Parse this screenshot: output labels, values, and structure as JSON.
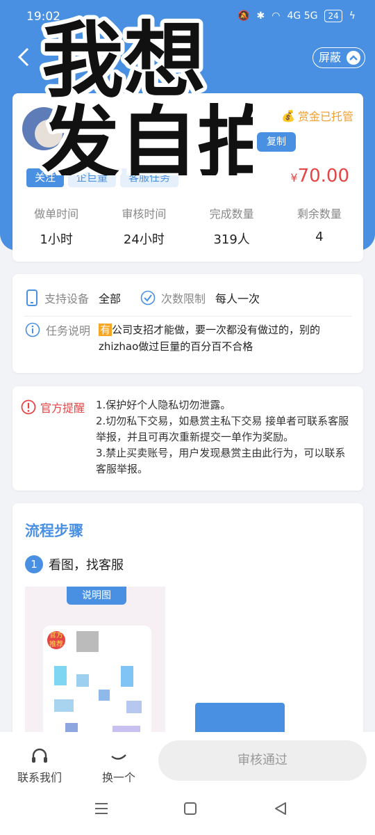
{
  "status_bar": {
    "time": "19:02",
    "network": "4G 5G",
    "battery": "24"
  },
  "header": {
    "shield_label": "屏蔽"
  },
  "sticker": {
    "line1": "我想",
    "line2": "发自拍"
  },
  "task": {
    "escrow_label": "赏金已托管",
    "copy_label": "复制",
    "tags": [
      "关注",
      "企巨量",
      "客服任务"
    ],
    "price_symbol": "¥",
    "price": "70.00",
    "stats": [
      {
        "label": "做单时间",
        "value": "1小时"
      },
      {
        "label": "审核时间",
        "value": "24小时"
      },
      {
        "label": "完成数量",
        "value": "319人"
      },
      {
        "label": "剩余数量",
        "value": "4"
      }
    ]
  },
  "details": {
    "device_label": "支持设备",
    "device_value": "全部",
    "limit_label": "次数限制",
    "limit_value": "每人一次",
    "desc_label": "任务说明",
    "desc_badge": "有",
    "desc_text": "公司支招才能做，要一次都没有做过的，别的zhizhao做过巨量的百分百不合格"
  },
  "notice": {
    "title": "官方提醒",
    "lines": [
      "1.保护好个人隐私切勿泄露。",
      "2.切勿私下交易，如悬赏主私下交易 接单者可联系客服举报，并且可再次重新提交一单作为奖励。",
      "3.禁止买卖账号，用户发现悬赏主由此行为，可以联系客服举报。"
    ]
  },
  "flow": {
    "title": "流程步骤",
    "step_number": "1",
    "step_text": "看图，找客服",
    "illus_label": "说明图",
    "illus_badge": "官方推荐"
  },
  "bottom": {
    "contact_label": "联系我们",
    "switch_label": "换一个",
    "approve_label": "审核通过"
  },
  "colors": {
    "primary": "#4a90e2",
    "price": "#e54545",
    "escrow": "#f0a030"
  }
}
